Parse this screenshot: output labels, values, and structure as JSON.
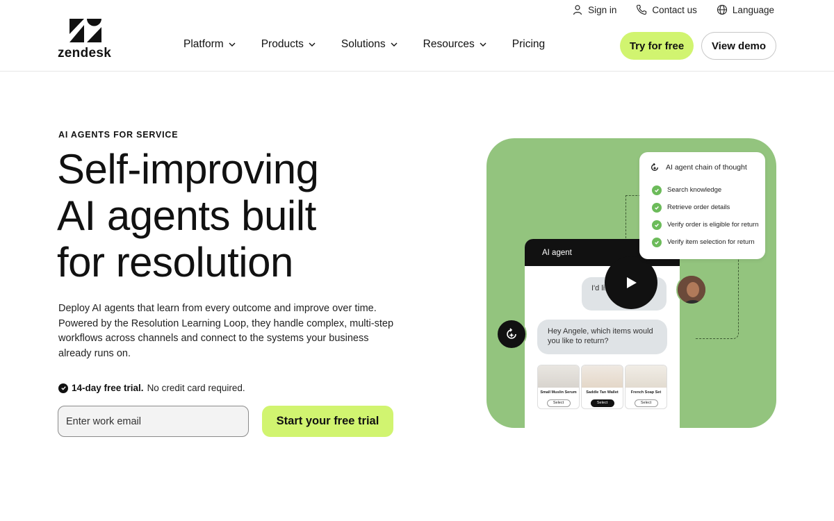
{
  "brand": {
    "name": "zendesk",
    "accent": "#d1f470",
    "illustration_bg": "#93c47e"
  },
  "utility_nav": [
    {
      "label": "Sign in",
      "icon": "person-icon"
    },
    {
      "label": "Contact us",
      "icon": "phone-icon"
    },
    {
      "label": "Language",
      "icon": "globe-icon"
    }
  ],
  "main_nav": [
    {
      "label": "Platform",
      "dropdown": true
    },
    {
      "label": "Products",
      "dropdown": true
    },
    {
      "label": "Solutions",
      "dropdown": true
    },
    {
      "label": "Resources",
      "dropdown": true
    },
    {
      "label": "Pricing",
      "dropdown": false
    }
  ],
  "header_buttons": {
    "try": "Try for free",
    "demo": "View demo"
  },
  "hero": {
    "eyebrow": "AI AGENTS FOR SERVICE",
    "headline_lines": [
      "Self-improving",
      "AI agents built",
      "for resolution"
    ],
    "description": "Deploy AI agents that learn from every outcome and improve over time. Powered by the Resolution Learning Loop, they handle complex, multi-step workflows across channels and connect to the systems your business already runs on.",
    "trial_bold": "14-day free trial.",
    "trial_rest": "No credit card required.",
    "email_placeholder": "Enter work email",
    "cta": "Start your free trial"
  },
  "illustration": {
    "chat_header": "AI agent",
    "user_message": "I'd li... my o...",
    "agent_message": "Hey Angele, which items would you like to return?",
    "products": [
      {
        "name": "Small Muslin Serum",
        "button": "Select",
        "selected": false
      },
      {
        "name": "Saddle Tan Wallet",
        "button": "Select",
        "selected": true
      },
      {
        "name": "French Soap Set",
        "button": "Select",
        "selected": false
      }
    ],
    "chain_of_thought": {
      "title": "AI agent chain of thought",
      "steps": [
        "Search knowledge",
        "Retrieve order details",
        "Verify order is eligible for return",
        "Verify item selection for return"
      ]
    }
  }
}
